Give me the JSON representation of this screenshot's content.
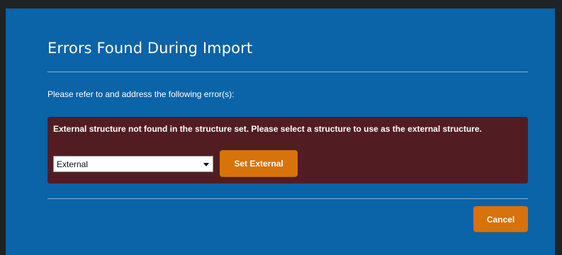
{
  "dialog": {
    "title": "Errors Found During Import",
    "instruction": "Please refer to and address the following error(s):",
    "error": {
      "message": "External structure not found in the structure set. Please select a structure to use as the external structure.",
      "select": {
        "selected_value": "External",
        "icon": "chevron-down-icon"
      },
      "set_button_label": "Set External"
    },
    "cancel_button_label": "Cancel"
  },
  "colors": {
    "dialog_background": "#0b63a8",
    "error_background": "#521d22",
    "button_accent": "#d8720b",
    "backdrop": "#1e2326"
  }
}
